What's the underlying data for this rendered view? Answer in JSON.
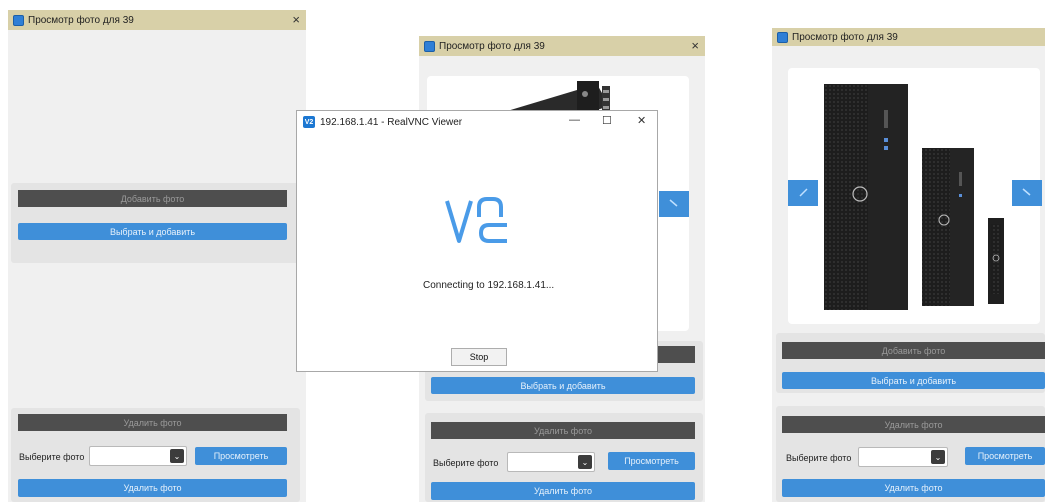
{
  "windows": {
    "left": {
      "title": "Просмотр фото для 39",
      "add_header": "Добавить фото",
      "choose_add_label": "Выбрать и добавить",
      "delete_header": "Удалить фото",
      "select_label": "Выберите фото",
      "view_label": "Просмотреть",
      "delete_label": "Удалить фото"
    },
    "middle": {
      "title": "Просмотр фото для 39",
      "choose_add_label": "Выбрать и добавить",
      "delete_header": "Удалить фото",
      "select_label": "Выберите фото",
      "view_label": "Просмотреть",
      "delete_label": "Удалить фото"
    },
    "right": {
      "title": "Просмотр фото для 39",
      "add_header": "Добавить фото",
      "choose_add_label": "Выбрать и добавить",
      "delete_header": "Удалить фото",
      "select_label": "Выберите фото",
      "view_label": "Просмотреть",
      "delete_label": "Удалить фото"
    }
  },
  "vnc": {
    "title": "192.168.1.41 - RealVNC Viewer",
    "icon_text": "V2",
    "status": "Connecting to 192.168.1.41...",
    "stop_label": "Stop",
    "minimize_glyph": "—",
    "maximize_glyph": "☐",
    "close_glyph": "✕"
  },
  "icons": {
    "close": "×",
    "dropdown": "⌄"
  },
  "colors": {
    "accent_blue": "#3f8fd9",
    "dark_header": "#4e4e4e",
    "titlebar": "#d8d0a8",
    "vnc_logo": "#4a9be8"
  }
}
